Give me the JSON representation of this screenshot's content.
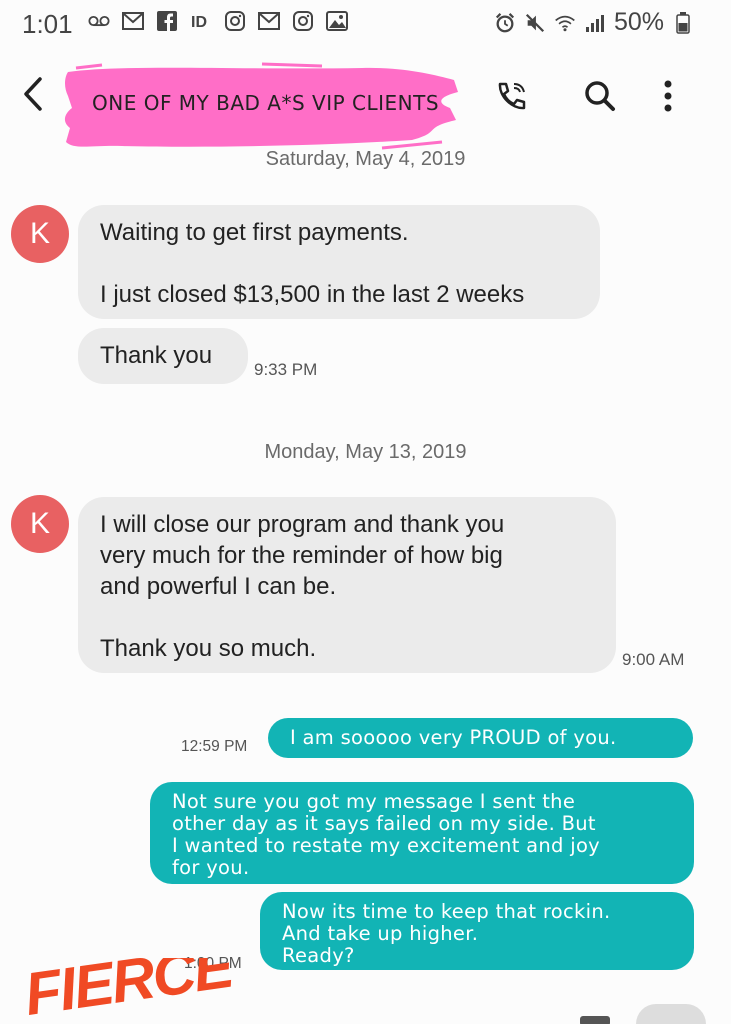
{
  "status": {
    "time": "1:01",
    "battery": "50%",
    "left_icons": [
      "voicemail-icon",
      "gmail-icon",
      "facebook-icon",
      "id-icon",
      "instagram-icon",
      "gmail-icon",
      "instagram-icon",
      "image-icon"
    ],
    "right_icons": [
      "alarm-icon",
      "mute-icon",
      "wifi-icon",
      "signal-icon",
      "battery-icon"
    ]
  },
  "header": {
    "title": "ONE OF MY BAD A*S VIP CLIENTS",
    "highlight_color": "#ff6ec7"
  },
  "conversation": {
    "date_1": "Saturday, May 4, 2019",
    "date_2": "Monday, May 13, 2019",
    "avatar_letter": "K",
    "messages": [
      {
        "direction": "in",
        "text": "Waiting to get first payments.\n\nI just closed $13,500 in the last 2 weeks"
      },
      {
        "direction": "in",
        "text": "Thank you",
        "time": "9:33 PM"
      },
      {
        "direction": "in",
        "text": "I will close our program and thank you\nvery much for the reminder of how big\nand powerful I can be.\n\nThank you so much.",
        "time": "9:00 AM"
      },
      {
        "direction": "out",
        "text": "I am sooooo very PROUD of you.",
        "time": "12:59 PM"
      },
      {
        "direction": "out",
        "text": "Not sure you got my message I sent the\nother day as it says failed on my side. But\nI wanted to restate my excitement and joy\nfor you."
      },
      {
        "direction": "out",
        "text": "Now its time to keep that rockin.\nAnd take up higher.\nReady?",
        "time": "1:00 PM"
      }
    ]
  },
  "overlay": {
    "sticker_text": "FIERCE"
  },
  "colors": {
    "incoming_bubble": "#ebebeb",
    "outgoing_bubble": "#12b4b5",
    "avatar": "#e86162"
  }
}
